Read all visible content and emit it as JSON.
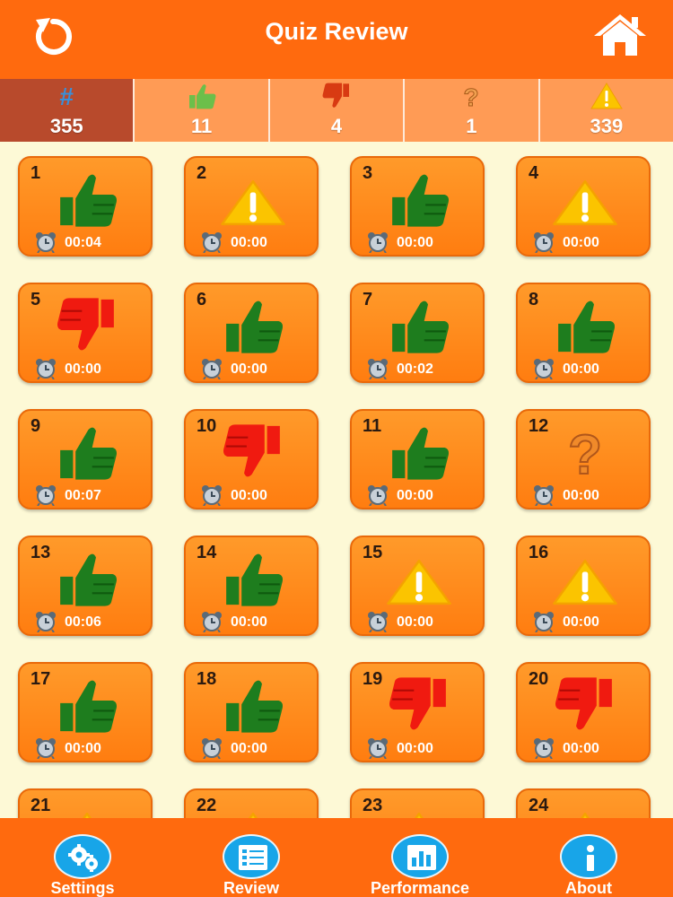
{
  "header": {
    "title": "Quiz Review",
    "left_icon": "refresh-icon",
    "right_icon": "home-icon"
  },
  "stats": [
    {
      "icon": "hash-icon",
      "glyph": "#",
      "value": "355",
      "active": true
    },
    {
      "icon": "thumb-up-icon",
      "value": "11",
      "active": false
    },
    {
      "icon": "thumb-down-icon",
      "value": "4",
      "active": false
    },
    {
      "icon": "question-icon",
      "value": "1",
      "active": false
    },
    {
      "icon": "warning-icon",
      "value": "339",
      "active": false
    }
  ],
  "questions": [
    {
      "num": "1",
      "status": "up",
      "time": "00:04"
    },
    {
      "num": "2",
      "status": "warn",
      "time": "00:00"
    },
    {
      "num": "3",
      "status": "up",
      "time": "00:00"
    },
    {
      "num": "4",
      "status": "warn",
      "time": "00:00"
    },
    {
      "num": "5",
      "status": "down",
      "time": "00:00"
    },
    {
      "num": "6",
      "status": "up",
      "time": "00:00"
    },
    {
      "num": "7",
      "status": "up",
      "time": "00:02"
    },
    {
      "num": "8",
      "status": "up",
      "time": "00:00"
    },
    {
      "num": "9",
      "status": "up",
      "time": "00:07"
    },
    {
      "num": "10",
      "status": "down",
      "time": "00:00"
    },
    {
      "num": "11",
      "status": "up",
      "time": "00:00"
    },
    {
      "num": "12",
      "status": "question",
      "time": "00:00"
    },
    {
      "num": "13",
      "status": "up",
      "time": "00:06"
    },
    {
      "num": "14",
      "status": "up",
      "time": "00:00"
    },
    {
      "num": "15",
      "status": "warn",
      "time": "00:00"
    },
    {
      "num": "16",
      "status": "warn",
      "time": "00:00"
    },
    {
      "num": "17",
      "status": "up",
      "time": "00:00"
    },
    {
      "num": "18",
      "status": "up",
      "time": "00:00"
    },
    {
      "num": "19",
      "status": "down",
      "time": "00:00"
    },
    {
      "num": "20",
      "status": "down",
      "time": "00:00"
    },
    {
      "num": "21",
      "status": "warn",
      "time": ""
    },
    {
      "num": "22",
      "status": "warn",
      "time": ""
    },
    {
      "num": "23",
      "status": "warn",
      "time": ""
    },
    {
      "num": "24",
      "status": "warn",
      "time": ""
    }
  ],
  "tabs": [
    {
      "label": "Settings",
      "icon": "gears-icon"
    },
    {
      "label": "Review",
      "icon": "list-icon"
    },
    {
      "label": "Performance",
      "icon": "bar-chart-icon"
    },
    {
      "label": "About",
      "icon": "info-icon"
    }
  ],
  "colors": {
    "header": "#ff6a0e",
    "background": "#fdf9d6",
    "tile": "#ff8a1c",
    "correct": "#1e7d1e",
    "wrong": "#f01a10",
    "warning": "#f5a200",
    "accent": "#18a5e8"
  }
}
